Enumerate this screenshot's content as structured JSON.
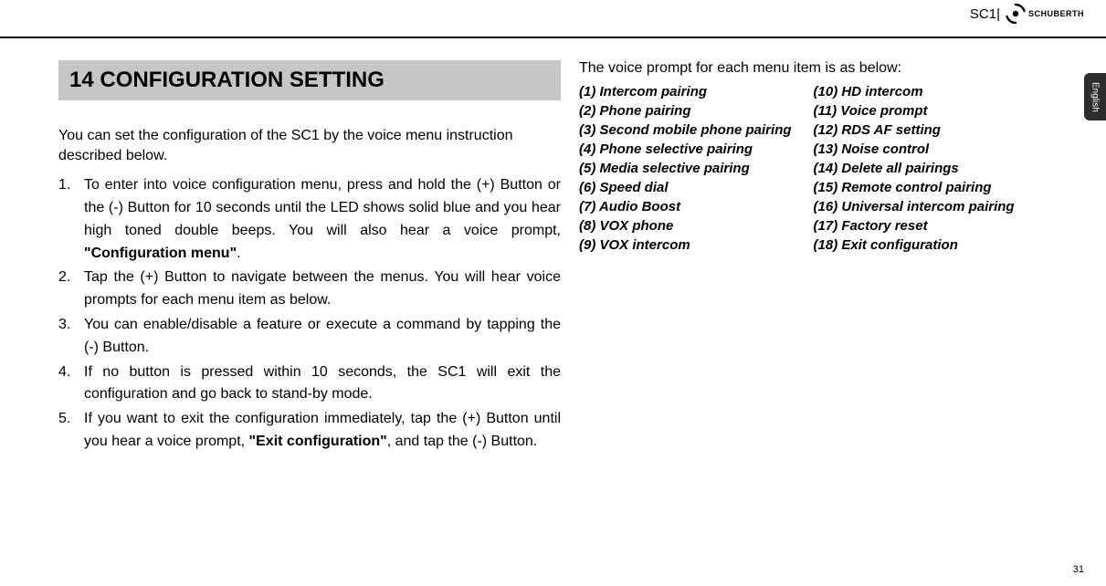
{
  "header": {
    "model": "SC1",
    "brand": "SCHUBERTH"
  },
  "lang_tab": "English",
  "section_title": "14 CONFIGURATION SETTING",
  "intro": "You can set the configuration of the SC1 by the voice menu instruction described below.",
  "steps": {
    "s1a": "To enter into voice configuration menu, press and hold the (+) Button or the (-) Button for 10 seconds until the LED shows solid blue and you hear high toned double beeps. You will also hear a voice prompt, ",
    "s1b": "\"Configuration menu\"",
    "s1c": ".",
    "s2": "Tap the (+) Button to navigate between the menus. You will hear voice prompts for each menu item as below.",
    "s3": "You can enable/disable a feature or execute a command by tapping the (-) Button.",
    "s4": "If no button is pressed within 10 seconds, the SC1 will exit the configuration and go back to stand-by mode.",
    "s5a": "If you want to exit the configuration immediately, tap the (+) Button until you hear a voice prompt, ",
    "s5b": "\"Exit configuration\"",
    "s5c": ", and tap the (-) Button."
  },
  "prompt_intro": "The voice prompt for each menu item is as below:",
  "prompts_left": [
    "(1) Intercom pairing",
    "(2) Phone pairing",
    "(3) Second mobile phone pairing",
    "(4) Phone selective pairing",
    "(5) Media selective pairing",
    "(6) Speed dial",
    "(7) Audio Boost",
    "(8) VOX phone",
    "(9) VOX intercom"
  ],
  "prompts_right": [
    "(10) HD intercom",
    "(11) Voice prompt",
    "(12) RDS AF setting",
    "(13) Noise control",
    "(14) Delete all pairings",
    "(15) Remote control pairing",
    "(16) Universal intercom pairing",
    "(17) Factory reset",
    "(18) Exit configuration"
  ],
  "page_number": "31"
}
